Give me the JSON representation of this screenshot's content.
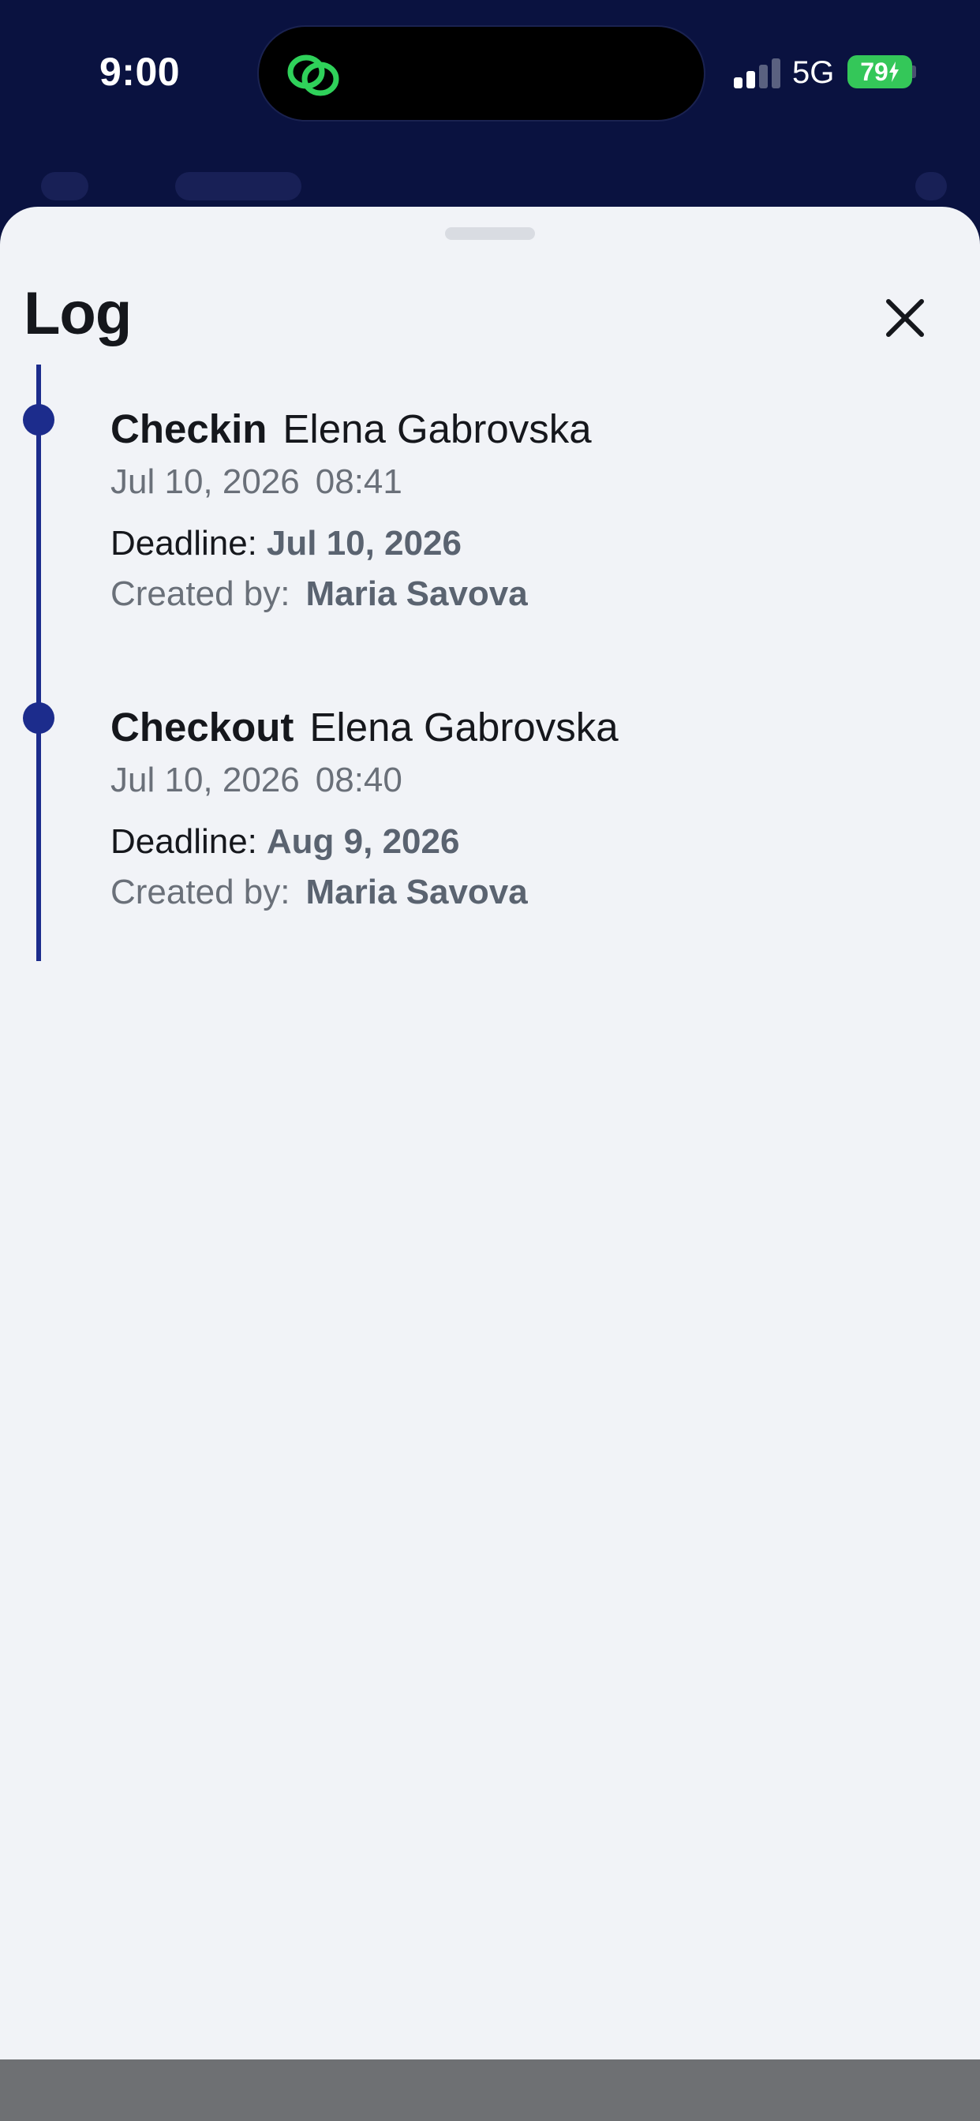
{
  "status_bar": {
    "time": "9:00",
    "network": "5G",
    "battery": "79",
    "island_icon": "link-rings-icon",
    "colors": {
      "battery": "#34c759",
      "island_icon": "#2fd15a"
    }
  },
  "sheet": {
    "title": "Log",
    "close_icon": "close-icon"
  },
  "log": {
    "entries": [
      {
        "type": "Checkin",
        "person": "Elena Gabrovska",
        "date": "Jul 10, 2026",
        "time": "08:41",
        "deadline_label": "Deadline:",
        "deadline": "Jul 10, 2026",
        "created_label": "Created by:",
        "created_by": "Maria Savova"
      },
      {
        "type": "Checkout",
        "person": "Elena Gabrovska",
        "date": "Jul 10, 2026",
        "time": "08:40",
        "deadline_label": "Deadline:",
        "deadline": "Aug 9, 2026",
        "created_label": "Created by:",
        "created_by": "Maria Savova"
      }
    ]
  },
  "colors": {
    "header_background": "#0a1240",
    "sheet_background": "#f1f3f7",
    "timeline": "#1c2c8c"
  }
}
